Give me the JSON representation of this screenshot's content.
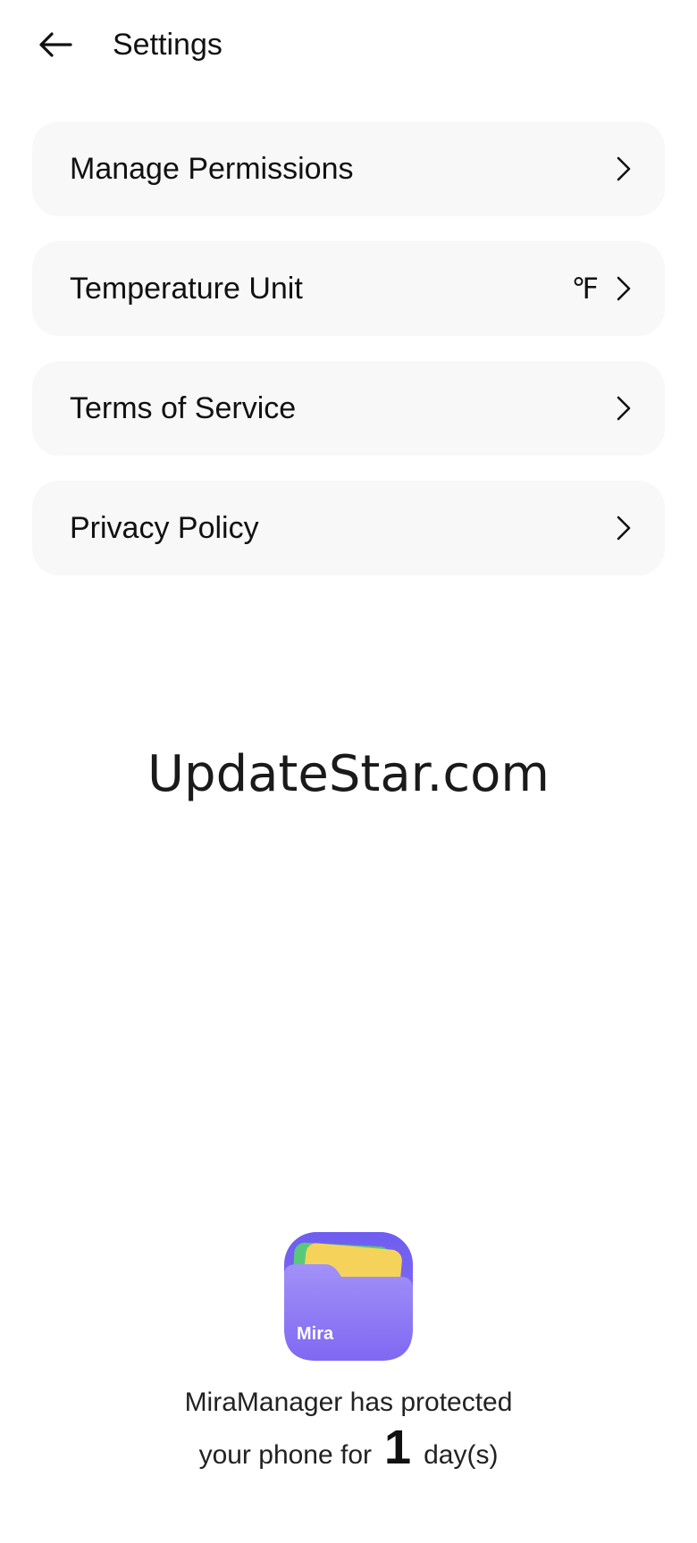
{
  "header": {
    "title": "Settings",
    "back_icon": "back-arrow-icon"
  },
  "settings_items": [
    {
      "label": "Manage Permissions",
      "value": "",
      "icon": "chevron-right-icon"
    },
    {
      "label": "Temperature Unit",
      "value": "℉",
      "icon": "chevron-right-icon"
    },
    {
      "label": "Terms of Service",
      "value": "",
      "icon": "chevron-right-icon"
    },
    {
      "label": "Privacy Policy",
      "value": "",
      "icon": "chevron-right-icon"
    }
  ],
  "watermark": "UpdateStar.com",
  "app": {
    "icon_label": "Mira",
    "icon": "folder-app-icon",
    "protection_line1": "MiraManager has protected",
    "protection_prefix": "your phone for",
    "days": "1",
    "protection_suffix": "day(s)"
  },
  "colors": {
    "card_background": "#f8f8f8",
    "icon_purple": "#7b68f0",
    "icon_yellow": "#f5d35a",
    "icon_green": "#58c97a"
  }
}
